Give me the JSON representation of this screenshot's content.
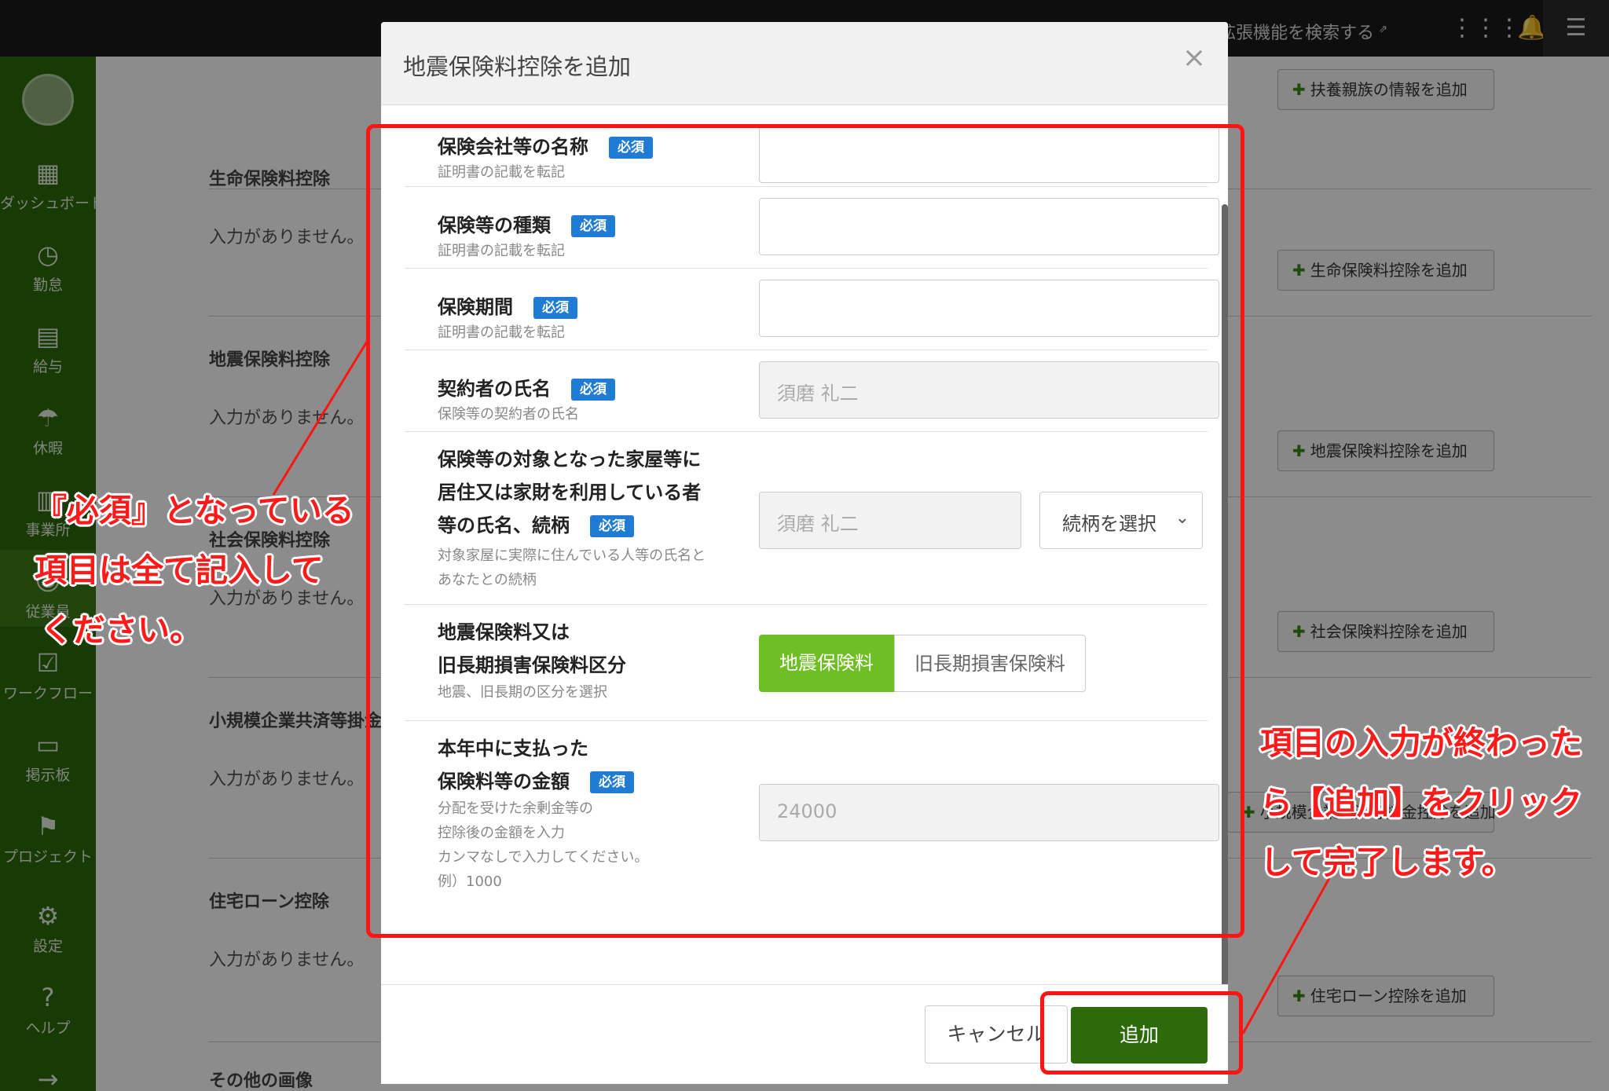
{
  "topbar": {
    "extension_link": "拡張機能を検索する",
    "extension_arrow": "⇗"
  },
  "sidebar": {
    "items": [
      {
        "label": "ダッシュボード",
        "icon": "▦"
      },
      {
        "label": "勤怠",
        "icon": "◷"
      },
      {
        "label": "給与",
        "icon": "▤"
      },
      {
        "label": "休暇",
        "icon": "☂"
      },
      {
        "label": "事業所",
        "icon": "▥"
      },
      {
        "label": "従業員",
        "icon": "☺"
      },
      {
        "label": "ワークフロー",
        "icon": "☑"
      },
      {
        "label": "掲示板",
        "icon": "▭"
      },
      {
        "label": "プロジェクト",
        "icon": "⚑"
      },
      {
        "label": "設定",
        "icon": "⚙"
      },
      {
        "label": "ヘルプ",
        "icon": "?"
      },
      {
        "label": "",
        "icon": "→"
      }
    ]
  },
  "background": {
    "sections": [
      {
        "title": "生命保険料控除",
        "empty": "入力がありません。"
      },
      {
        "title": "地震保険料控除",
        "empty": "入力がありません。"
      },
      {
        "title": "社会保険料控除",
        "empty": "入力がありません。"
      },
      {
        "title": "小規模企業共済等掛金控除",
        "empty": "入力がありません。"
      },
      {
        "title": "住宅ローン控除",
        "empty": "入力がありません。"
      },
      {
        "title": "その他の画像",
        "empty": ""
      }
    ],
    "buttons": [
      "扶養親族の情報を追加",
      "生命保険料控除を追加",
      "地震保険料控除を追加",
      "社会保険料控除を追加",
      "小規模企業共済等掛金控除を追加",
      "住宅ローン控除を追加"
    ]
  },
  "modal": {
    "title": "地震保険料控除を追加",
    "close": "×",
    "required_badge": "必須",
    "fields": {
      "company": {
        "label": "保険会社等の名称",
        "hint": "証明書の記載を転記",
        "value": ""
      },
      "kind": {
        "label": "保険等の種類",
        "hint": "証明書の記載を転記",
        "value": ""
      },
      "period": {
        "label": "保険期間",
        "hint": "証明書の記載を転記",
        "value": ""
      },
      "contractor": {
        "label": "契約者の氏名",
        "hint": "保険等の契約者の氏名",
        "placeholder": "須磨 礼二"
      },
      "resident": {
        "label_lines": [
          "保険等の対象となった家屋等に",
          "居住又は家財を利用している者",
          "等の氏名、続柄"
        ],
        "hint_lines": [
          "対象家屋に実際に住んでいる人等の氏名と",
          "あなたとの続柄"
        ],
        "placeholder": "須磨 礼二",
        "relation_select": "続柄を選択"
      },
      "category": {
        "label_lines": [
          "地震保険料又は",
          "旧長期損害保険料区分"
        ],
        "hint": "地震、旧長期の区分を選択",
        "options": [
          "地震保険料",
          "旧長期損害保険料"
        ],
        "selected": "地震保険料"
      },
      "amount": {
        "label_lines": [
          "本年中に支払った",
          "保険料等の金額"
        ],
        "hint_lines": [
          "分配を受けた余剰金等の",
          "控除後の金額を入力",
          "カンマなしで入力してください。",
          "例）1000"
        ],
        "placeholder": "24000"
      }
    },
    "cancel": "キャンセル",
    "submit": "追加"
  },
  "annotations": {
    "left_note": [
      "『必須』となっている",
      "項目は全て記入して",
      "ください。"
    ],
    "right_note": [
      "項目の入力が終わった",
      "ら【追加】をクリック",
      "して完了します。"
    ],
    "color": "#ff1a1a"
  },
  "colors": {
    "brand_green": "#2d6a09",
    "segment_green": "#6fbe23",
    "required_blue": "#1f7bd3"
  }
}
